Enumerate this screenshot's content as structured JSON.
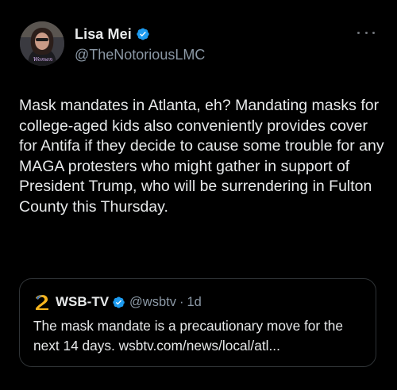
{
  "tweet": {
    "author": {
      "display_name": "Lisa Mei",
      "handle": "@TheNotoriousLMC",
      "verified": true,
      "avatar_text": "Women"
    },
    "body": "Mask mandates in Atlanta, eh? Mandating masks for college-aged kids also conveniently provides cover for Antifa if they decide to cause some trouble for any MAGA protesters who might gather in support of President Trump, who will be surrendering in Fulton County this Thursday.",
    "more_icon": "more-horizontal-icon"
  },
  "quoted": {
    "display_name": "WSB-TV",
    "handle": "@wsbtv",
    "separator": "·",
    "time": "1d",
    "verified": true,
    "text": "The mask mandate is a precautionary move for the next 14 days.  wsbtv.com/news/local/atl..."
  },
  "colors": {
    "background": "#000000",
    "primary_text": "#e7e9ea",
    "secondary_text": "#8b98a5",
    "verified_blue": "#1d9bf0",
    "border": "#2f3336",
    "wsb_gold": "#f5b41e"
  }
}
